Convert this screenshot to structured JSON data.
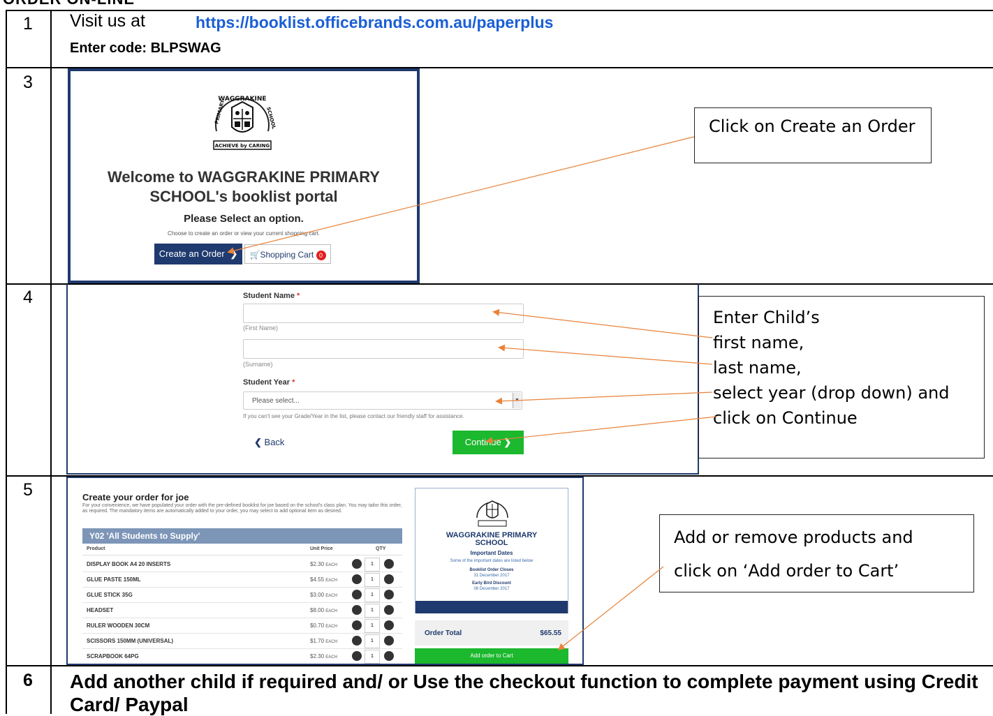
{
  "heading": "ORDER ON-LINE",
  "steps": {
    "s1": {
      "num": "1",
      "visit": "Visit us at",
      "url": "https://booklist.officebrands.com.au/paperplus",
      "code": "Enter code: BLPSWAG"
    },
    "s3": {
      "num": "3",
      "callout": "Click on Create an Order"
    },
    "s4": {
      "num": "4",
      "callout_lines": [
        "Enter Child’s",
        "first name,",
        "last name,",
        "select year (drop down) and",
        "click on Continue"
      ]
    },
    "s5": {
      "num": "5",
      "callout_line1": "Add or remove products and",
      "callout_line2": "click on ‘Add order to Cart’"
    },
    "s6": {
      "num": "6",
      "text": "Add another child if required and/ or Use the checkout function to complete payment using Credit Card/ Paypal"
    }
  },
  "portal": {
    "crest_text": "WAGGRAKINE PRIMARY SCHOOL",
    "crest_motto": "ACHIEVE by CARING",
    "welcome_line1": "Welcome to WAGGRAKINE PRIMARY",
    "welcome_line2": "SCHOOL's booklist portal",
    "select_option": "Please Select an option.",
    "choose_text": "Choose to create an order or view your current shopping cart.",
    "create_btn": "Create an Order",
    "cart_btn": "Shopping Cart",
    "cart_count": "0"
  },
  "form": {
    "student_name_label": "Student Name",
    "first_hint": "(First Name)",
    "surname_hint": "(Surname)",
    "year_label": "Student Year",
    "year_placeholder": "Please select...",
    "help_text": "If you can't see your Grade/Year in the list, please contact our friendly staff for assistance.",
    "back": "Back",
    "continue": "Continue"
  },
  "order": {
    "title": "Create your order for joe",
    "desc": "For your convenience, we have populated your order with the pre-defined booklist for joe based on the school's class plan. You may tailor this order, as required. The mandatory items are automatically added to your order, you may select to add optional item as desired.",
    "list_title": "Y02 'All Students to Supply'",
    "col_product": "Product",
    "col_price": "Unit Price",
    "col_qty": "QTY",
    "each": "EACH",
    "items": [
      {
        "name": "DISPLAY BOOK A4 20 INSERTS",
        "price": "$2.30",
        "qty": "1"
      },
      {
        "name": "GLUE PASTE 150ML",
        "price": "$4.55",
        "qty": "1"
      },
      {
        "name": "GLUE STICK 35G",
        "price": "$3.00",
        "qty": "1"
      },
      {
        "name": "HEADSET",
        "price": "$8.00",
        "qty": "1"
      },
      {
        "name": "RULER WOODEN 30CM",
        "price": "$0.70",
        "qty": "1"
      },
      {
        "name": "SCISSORS 150MM (UNIVERSAL)",
        "price": "$1.70",
        "qty": "1"
      },
      {
        "name": "SCRAPBOOK 64PG",
        "price": "$2.30",
        "qty": "1"
      }
    ],
    "side_school1": "WAGGRAKINE PRIMARY",
    "side_school2": "SCHOOL",
    "important_dates": "Important Dates",
    "dates_intro": "Some of the important dates are listed below",
    "d1_title": "Booklist Order Closes",
    "d1_date": "31 December 2017",
    "d2_title": "Early Bird Discount",
    "d2_date": "08 December 2017",
    "total_label": "Order Total",
    "total_value": "$65.55",
    "add_btn": "Add order to Cart"
  },
  "colors": {
    "navy": "#1f3a6e",
    "arrow": "#e8823a",
    "green": "#1cb82e",
    "link": "#1a5fd6"
  }
}
